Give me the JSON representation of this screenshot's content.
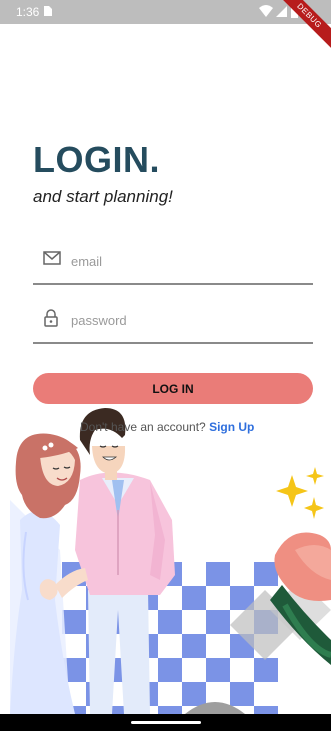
{
  "status_bar": {
    "time": "1:36",
    "debug_label": "DEBUG",
    "icons": [
      "sim-card-icon",
      "wifi-icon",
      "signal-icon",
      "battery-icon"
    ]
  },
  "login": {
    "title": "LOGIN.",
    "subtitle": "and start planning!",
    "email_placeholder": "email",
    "email_value": "",
    "password_placeholder": "password",
    "password_value": "",
    "button_label": "LOG IN",
    "signup_prompt": "Don't have an account?",
    "signup_link": "Sign Up"
  },
  "colors": {
    "title": "#254c5e",
    "button": "#ea7c78",
    "link": "#2f6fdd",
    "checker": "#7b93e6"
  }
}
